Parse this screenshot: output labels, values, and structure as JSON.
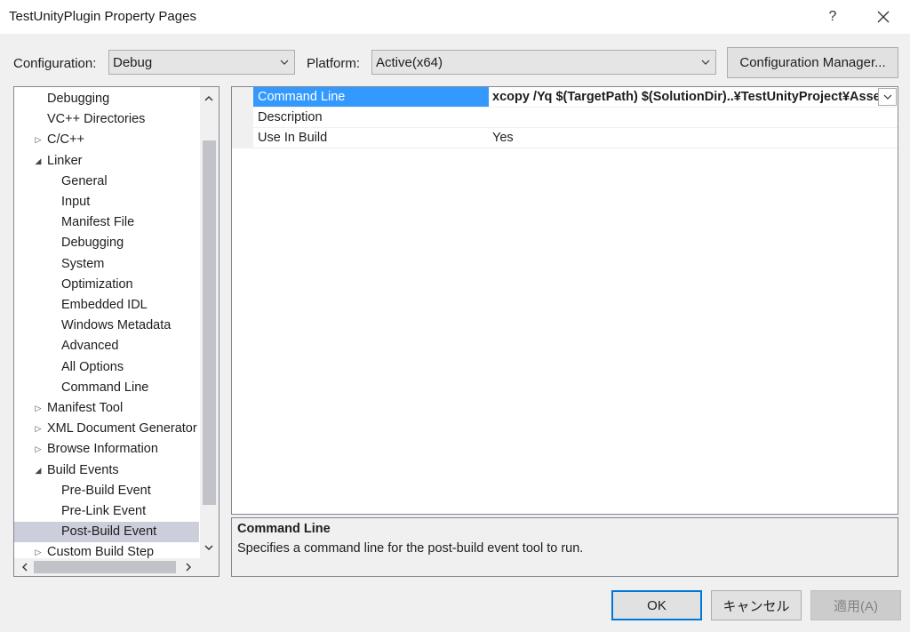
{
  "window": {
    "title": "TestUnityPlugin Property Pages",
    "help_label": "?"
  },
  "config": {
    "configuration_label": "Configuration:",
    "configuration_value": "Debug",
    "platform_label": "Platform:",
    "platform_value": "Active(x64)",
    "manager_button": "Configuration Manager..."
  },
  "tree": {
    "items": [
      {
        "label": "Debugging",
        "level": 1,
        "expander": "none"
      },
      {
        "label": "VC++ Directories",
        "level": 1,
        "expander": "none"
      },
      {
        "label": "C/C++",
        "level": 1,
        "expander": "collapsed"
      },
      {
        "label": "Linker",
        "level": 1,
        "expander": "expanded"
      },
      {
        "label": "General",
        "level": 2,
        "expander": "none"
      },
      {
        "label": "Input",
        "level": 2,
        "expander": "none"
      },
      {
        "label": "Manifest File",
        "level": 2,
        "expander": "none"
      },
      {
        "label": "Debugging",
        "level": 2,
        "expander": "none"
      },
      {
        "label": "System",
        "level": 2,
        "expander": "none"
      },
      {
        "label": "Optimization",
        "level": 2,
        "expander": "none"
      },
      {
        "label": "Embedded IDL",
        "level": 2,
        "expander": "none"
      },
      {
        "label": "Windows Metadata",
        "level": 2,
        "expander": "none"
      },
      {
        "label": "Advanced",
        "level": 2,
        "expander": "none"
      },
      {
        "label": "All Options",
        "level": 2,
        "expander": "none"
      },
      {
        "label": "Command Line",
        "level": 2,
        "expander": "none"
      },
      {
        "label": "Manifest Tool",
        "level": 1,
        "expander": "collapsed"
      },
      {
        "label": "XML Document Generator",
        "level": 1,
        "expander": "collapsed"
      },
      {
        "label": "Browse Information",
        "level": 1,
        "expander": "collapsed"
      },
      {
        "label": "Build Events",
        "level": 1,
        "expander": "expanded"
      },
      {
        "label": "Pre-Build Event",
        "level": 2,
        "expander": "none"
      },
      {
        "label": "Pre-Link Event",
        "level": 2,
        "expander": "none"
      },
      {
        "label": "Post-Build Event",
        "level": 2,
        "expander": "none",
        "selected": true
      },
      {
        "label": "Custom Build Step",
        "level": 1,
        "expander": "collapsed"
      }
    ]
  },
  "grid": {
    "rows": [
      {
        "name": "Command Line",
        "value": "xcopy /Yq $(TargetPath) $(SolutionDir)..¥TestUnityProject¥Assets¥Plugins",
        "selected": true
      },
      {
        "name": "Description",
        "value": ""
      },
      {
        "name": "Use In Build",
        "value": "Yes"
      }
    ]
  },
  "description": {
    "title": "Command Line",
    "text": "Specifies a command line for the post-build event tool to run."
  },
  "buttons": {
    "ok": "OK",
    "cancel": "キャンセル",
    "apply": "適用(A)"
  },
  "colors": {
    "selection_blue": "#3399ff",
    "tree_selection": "#cccedb",
    "default_button_border": "#0078d7"
  }
}
